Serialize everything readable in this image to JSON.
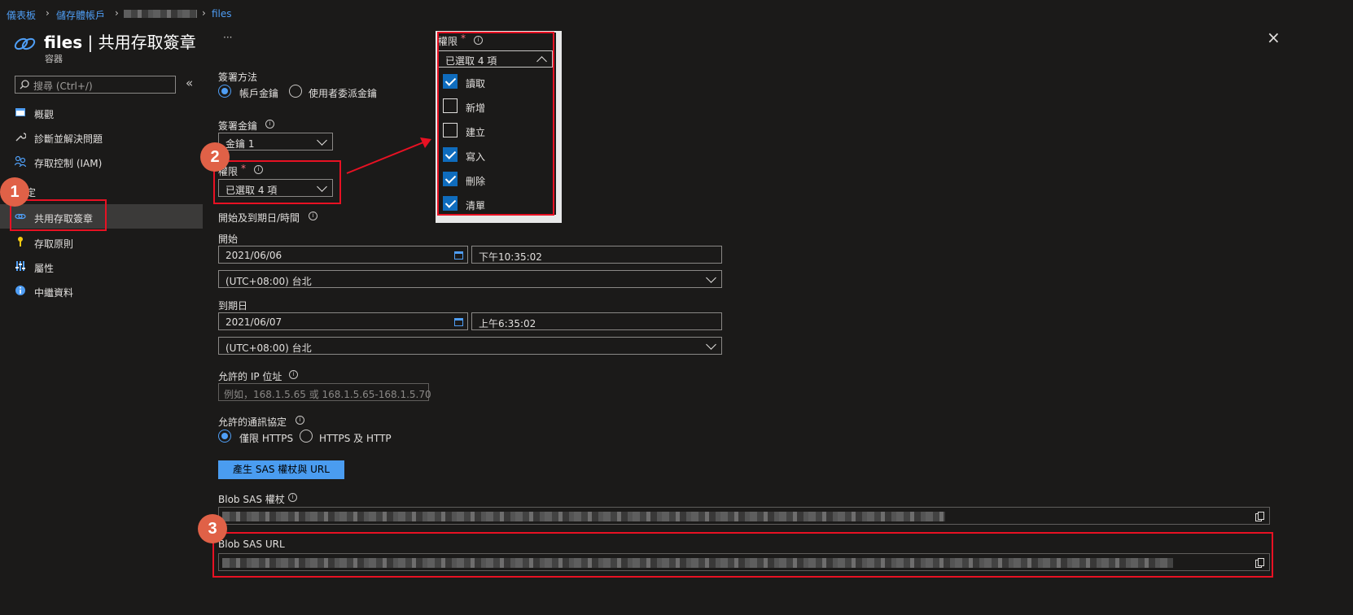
{
  "breadcrumb": {
    "items": [
      "儀表板",
      "儲存體帳戶",
      "files"
    ]
  },
  "header": {
    "title_main": "files",
    "title_sep": " | ",
    "title_sub": "共用存取簽章",
    "subtitle": "容器",
    "more": "···",
    "close": "×"
  },
  "sidebar": {
    "search_placeholder": "搜尋 (Ctrl+/)",
    "collapse": "«",
    "items": [
      {
        "label": "概觀",
        "icon": "overview-icon"
      },
      {
        "label": "診斷並解決問題",
        "icon": "wrench-icon"
      },
      {
        "label": "存取控制 (IAM)",
        "icon": "people-icon"
      }
    ],
    "section_label": "定",
    "section_items": [
      {
        "label": "共用存取簽章",
        "icon": "link-icon",
        "selected": true
      },
      {
        "label": "存取原則",
        "icon": "key-icon"
      },
      {
        "label": "屬性",
        "icon": "properties-icon"
      },
      {
        "label": "中繼資料",
        "icon": "info-icon"
      }
    ]
  },
  "form": {
    "signing_method_label": "簽署方法",
    "signing_options": [
      "帳戶金鑰",
      "使用者委派金鑰"
    ],
    "signing_key_label": "簽署金鑰",
    "signing_key_value": "金鑰 1",
    "permissions_label": "權限",
    "required_mark": "*",
    "permissions_value": "已選取 4 項",
    "start_expiry_label": "開始及到期日/時間",
    "start_label": "開始",
    "start_date": "2021/06/06",
    "start_time": "下午10:35:02",
    "start_tz": "(UTC+08:00) 台北",
    "expiry_label": "到期日",
    "expiry_date": "2021/06/07",
    "expiry_time": "上午6:35:02",
    "expiry_tz": "(UTC+08:00) 台北",
    "ip_label": "允許的 IP 位址",
    "ip_placeholder": "例如，168.1.5.65 或 168.1.5.65-168.1.5.70",
    "protocol_label": "允許的通訊協定",
    "protocol_options": [
      "僅限 HTTPS",
      "HTTPS 及 HTTP"
    ],
    "generate_button": "產生 SAS 權杖與 URL",
    "token_label": "Blob SAS 權杖",
    "url_label": "Blob SAS URL"
  },
  "dropdown": {
    "label": "權限",
    "value": "已選取 4 項",
    "options": [
      {
        "label": "讀取",
        "checked": true
      },
      {
        "label": "新增",
        "checked": false
      },
      {
        "label": "建立",
        "checked": false
      },
      {
        "label": "寫入",
        "checked": true
      },
      {
        "label": "刪除",
        "checked": true
      },
      {
        "label": "清單",
        "checked": true
      }
    ]
  },
  "callouts": [
    "1",
    "2",
    "3"
  ],
  "colors": {
    "accent": "#4f9ef5",
    "button": "#4a9cf0",
    "annotation": "#e81123",
    "badge": "#e06147",
    "background": "#1b1a19"
  }
}
